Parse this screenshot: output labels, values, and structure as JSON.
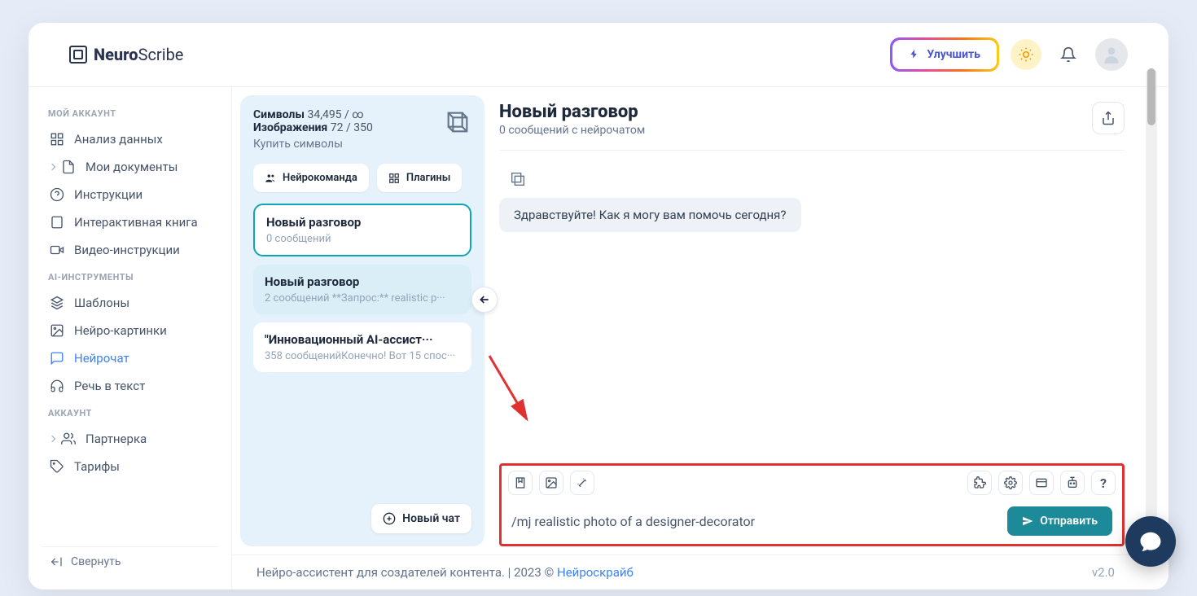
{
  "logo": {
    "bold": "Neuro",
    "light": "Scribe"
  },
  "header": {
    "upgrade": "Улучшить"
  },
  "sidebar": {
    "sec_account": "МОЙ АККАУНТ",
    "items1": [
      {
        "label": "Анализ данных"
      },
      {
        "label": "Мои документы"
      },
      {
        "label": "Инструкции"
      },
      {
        "label": "Интерактивная книга"
      },
      {
        "label": "Видео-инструкции"
      }
    ],
    "sec_ai": "AI-ИНСТРУМЕНТЫ",
    "items2": [
      {
        "label": "Шаблоны"
      },
      {
        "label": "Нейро-картинки"
      },
      {
        "label": "Нейрочат"
      },
      {
        "label": "Речь в текст"
      }
    ],
    "sec_acc": "АККАУНТ",
    "items3": [
      {
        "label": "Партнерка"
      },
      {
        "label": "Тарифы"
      }
    ],
    "collapse": "Свернуть"
  },
  "chatlist": {
    "symbols_label": "Символы",
    "symbols_val": "34,495 / ∞",
    "images_label": "Изображения",
    "images_val": "72 / 350",
    "buy": "Купить символы",
    "tab1": "Нейрокоманда",
    "tab2": "Плагины",
    "conversations": [
      {
        "title": "Новый разговор",
        "sub": "0 сообщений"
      },
      {
        "title": "Новый разговор",
        "sub": "2 сообщений    **Запрос:** realistic p···"
      },
      {
        "title": "\"Инновационный AI-ассист···",
        "sub": "358 сообщенийКонечно! Вот 15 спос···"
      }
    ],
    "new_chat": "Новый чат"
  },
  "chat": {
    "title": "Новый разговор",
    "subtitle": "0 сообщений с нейрочатом",
    "greeting": "Здравствуйте! Как я могу вам помочь сегодня?",
    "input_value": "/mj realistic photo of a designer-decorator",
    "send": "Отправить",
    "help": "?"
  },
  "footer": {
    "text": "Нейро-ассистент для создателей контента.  | 2023 © ",
    "link": "Нейроскрайб",
    "version": "v2.0"
  }
}
